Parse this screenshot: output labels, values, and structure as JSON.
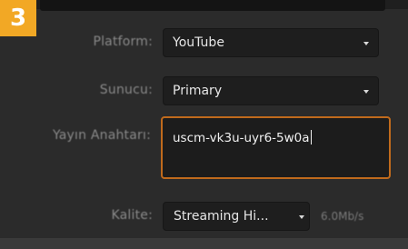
{
  "step": {
    "number": "3",
    "color": "#f2a825"
  },
  "form": {
    "platform": {
      "label": "Platform:",
      "value": "YouTube",
      "icon": "chevron-down-icon"
    },
    "server": {
      "label": "Sunucu:",
      "value": "Primary",
      "icon": "chevron-down-icon"
    },
    "stream_key": {
      "label": "Yayın Anahtarı:",
      "value": "uscm-vk3u-uyr6-5w0a"
    },
    "quality": {
      "label": "Kalite:",
      "value": "Streaming Hi...",
      "icon": "chevron-down-icon",
      "bitrate": "6.0Mb/s"
    }
  },
  "colors": {
    "panel_bg": "#2b2b2b",
    "field_bg": "#1e1e1e",
    "focus_border": "#c06a1c"
  }
}
